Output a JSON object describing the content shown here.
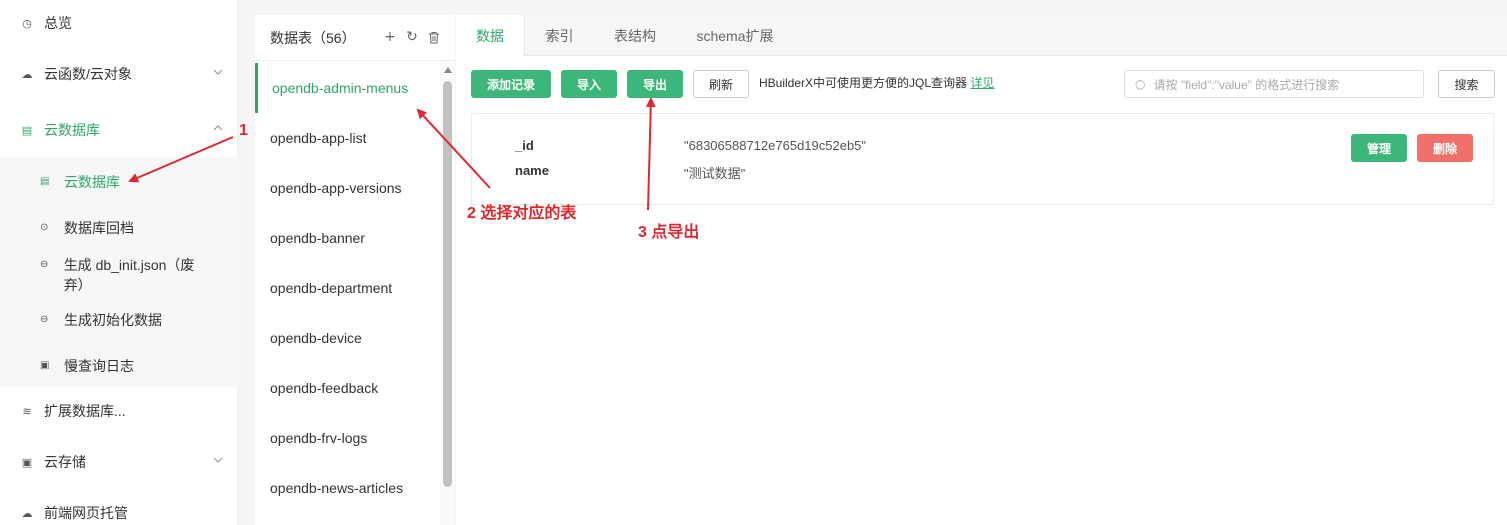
{
  "nav": {
    "items": [
      {
        "label": "总览",
        "icon": "clock-icon"
      },
      {
        "label": "云函数/云对象",
        "icon": "cloud-icon"
      },
      {
        "label": "云数据库",
        "icon": "database-list-icon"
      },
      {
        "label": "扩展数据库...",
        "icon": "database-icon"
      },
      {
        "label": "云存储",
        "icon": "storage-icon"
      },
      {
        "label": "前端网页托管",
        "icon": "hosting-icon"
      }
    ],
    "sub_items": [
      {
        "label": "云数据库",
        "icon": "database-list-icon"
      },
      {
        "label": "数据库回档",
        "icon": "restore-icon"
      },
      {
        "label": "生成 db_init.json（废弃）",
        "icon": "link-icon"
      },
      {
        "label": "生成初始化数据",
        "icon": "link-icon"
      },
      {
        "label": "慢查询日志",
        "icon": "log-icon"
      }
    ]
  },
  "tables": {
    "title": "数据表（56）",
    "items": [
      "opendb-admin-menus",
      "opendb-app-list",
      "opendb-app-versions",
      "opendb-banner",
      "opendb-department",
      "opendb-device",
      "opendb-feedback",
      "opendb-frv-logs",
      "opendb-news-articles"
    ]
  },
  "tabs": [
    "数据",
    "索引",
    "表结构",
    "schema扩展"
  ],
  "toolbar": {
    "add_label": "添加记录",
    "import_label": "导入",
    "export_label": "导出",
    "refresh_label": "刷新",
    "hint_text": "HBuilderX中可使用更方便的JQL查询器",
    "hint_link": "详见",
    "search_placeholder": "请按 \"field\":\"value\" 的格式进行搜索",
    "search_label": "搜索"
  },
  "record": {
    "id_key": "_id",
    "id_value": "\"68306588712e765d19c52eb5\"",
    "name_key": "name",
    "name_value": "\"测试数据\"",
    "manage_label": "管理",
    "delete_label": "删除"
  },
  "annotations": [
    "1",
    "2 选择对应的表",
    "3 点导出"
  ],
  "colors": {
    "accent": "#2fa866",
    "button_green": "#3db67a",
    "delete_red": "#f0706a",
    "annotation_red": "#e0282f"
  }
}
